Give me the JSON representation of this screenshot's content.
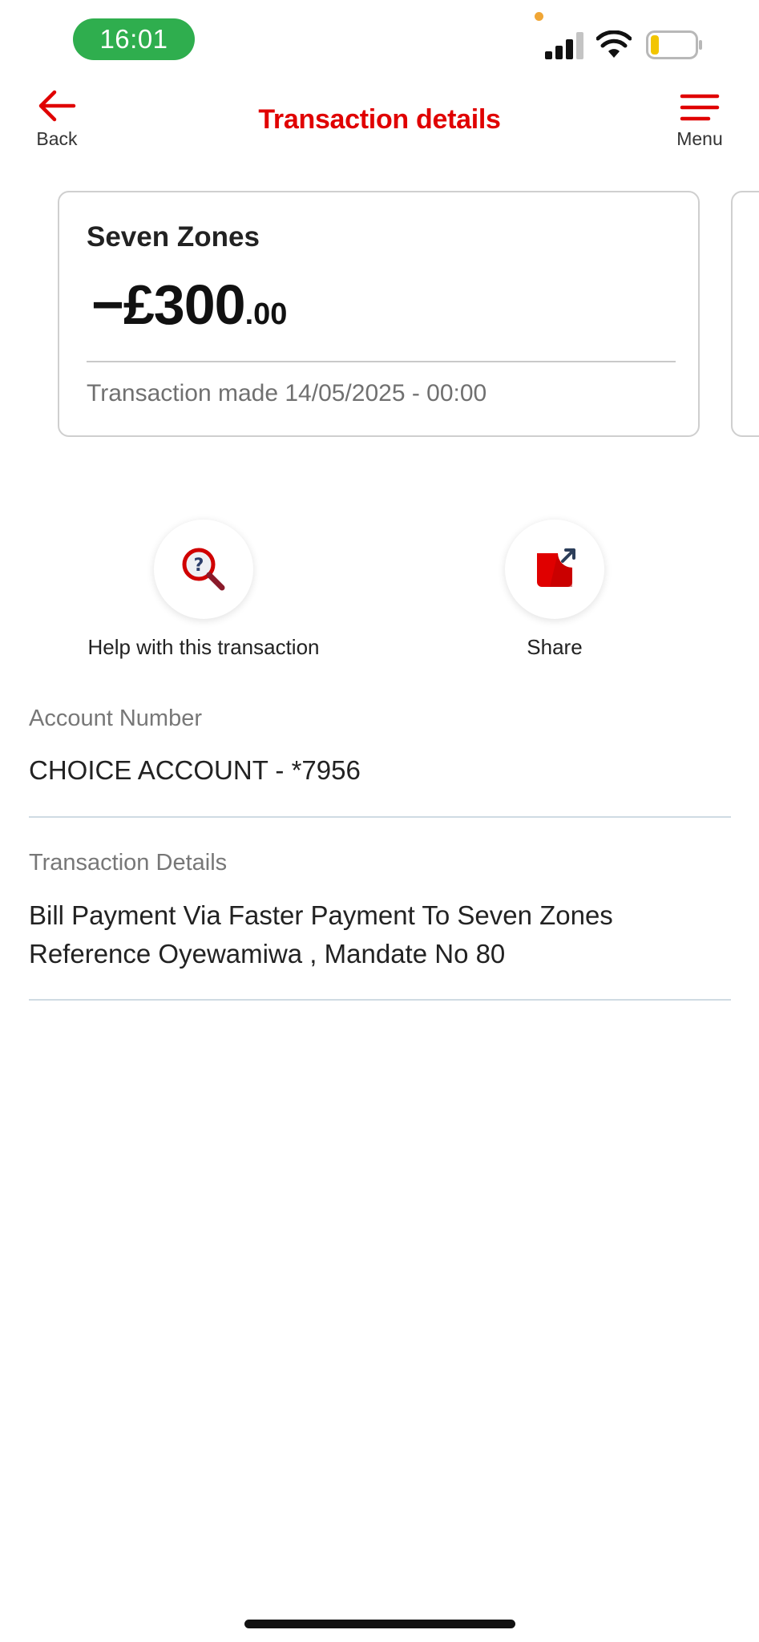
{
  "status_bar": {
    "time": "16:01",
    "icons": [
      "cellular-signal-icon",
      "wifi-icon",
      "battery-low-icon"
    ],
    "time_pill_color": "#2fae4e"
  },
  "header": {
    "back_label": "Back",
    "title": "Transaction details",
    "menu_label": "Menu",
    "accent_color": "#e00000"
  },
  "transaction_card": {
    "payee": "Seven Zones",
    "amount_main": "−£300",
    "amount_pence": ".00",
    "made_label": "Transaction made",
    "made_datetime": "14/05/2025 - 00:00"
  },
  "actions": [
    {
      "label": "Help with this transaction",
      "icon": "help-search-icon"
    },
    {
      "label": "Share",
      "icon": "share-icon"
    }
  ],
  "details": {
    "account_number_label": "Account Number",
    "account_number_value": "CHOICE ACCOUNT - *7956",
    "transaction_details_label": "Transaction Details",
    "transaction_details_value": "Bill Payment Via Faster Payment To Seven Zones Reference Oyewamiwa , Mandate No 80"
  }
}
